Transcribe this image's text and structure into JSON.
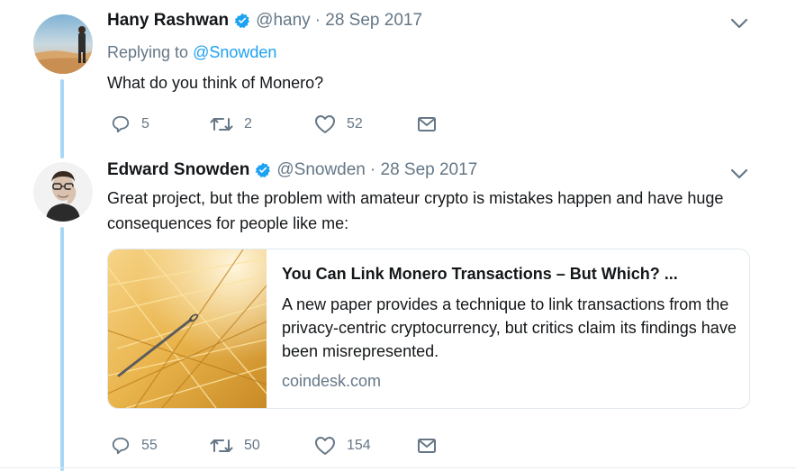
{
  "tweets": [
    {
      "name": "Hany Rashwan",
      "handle": "@hany",
      "date": "· 28 Sep 2017",
      "replying_prefix": "Replying to",
      "replying_to": "@Snowden",
      "text": "What do you think of Monero?",
      "reply_count": "5",
      "retweet_count": "2",
      "like_count": "52"
    },
    {
      "name": "Edward Snowden",
      "handle": "@Snowden",
      "date": "· 28 Sep 2017",
      "text": "Great project, but the problem with amateur crypto is mistakes happen and have huge consequences for people like me:",
      "card": {
        "title": "You Can Link Monero Transactions – But Which? ...",
        "description": "A new paper provides a technique to link transactions from the privacy-centric cryptocurrency, but critics claim its findings have been misrepresented.",
        "domain": "coindesk.com"
      },
      "reply_count": "55",
      "retweet_count": "50",
      "like_count": "154"
    }
  ],
  "icons": {
    "reply": "reply-icon",
    "retweet": "retweet-icon",
    "like": "heart-icon",
    "dm": "envelope-icon",
    "verified": "verified-badge-icon",
    "caret": "chevron-down-icon"
  },
  "colors": {
    "accent": "#1da1f2",
    "thread_line": "#a8d7f5",
    "muted_text": "#657786"
  }
}
